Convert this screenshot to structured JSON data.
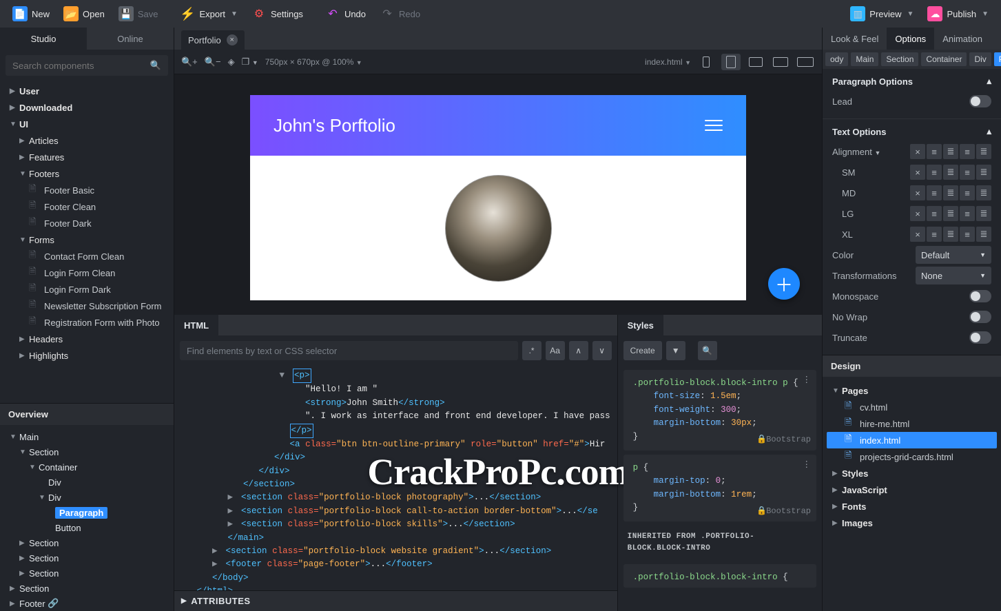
{
  "top": {
    "new": "New",
    "open": "Open",
    "save": "Save",
    "export": "Export",
    "settings": "Settings",
    "undo": "Undo",
    "redo": "Redo",
    "preview": "Preview",
    "publish": "Publish"
  },
  "leftTabs": {
    "studio": "Studio",
    "online": "Online"
  },
  "search": {
    "placeholder": "Search components"
  },
  "componentTree": {
    "user": "User",
    "downloaded": "Downloaded",
    "ui": "UI",
    "articles": "Articles",
    "features": "Features",
    "footers": "Footers",
    "footerBasic": "Footer Basic",
    "footerClean": "Footer Clean",
    "footerDark": "Footer Dark",
    "forms": "Forms",
    "contactFormClean": "Contact Form Clean",
    "loginFormClean": "Login Form Clean",
    "loginFormDark": "Login Form Dark",
    "newsletter": "Newsletter Subscription Form",
    "registration": "Registration Form with Photo",
    "headers": "Headers",
    "highlights": "Highlights"
  },
  "overview": {
    "title": "Overview",
    "main": "Main",
    "section": "Section",
    "container": "Container",
    "div": "Div",
    "paragraph": "Paragraph",
    "button": "Button",
    "footer": "Footer"
  },
  "docTab": "Portfolio",
  "dims": "750px × 670px @ 100%",
  "currentFile": "index.html",
  "pageTitle": "John's Porftolio",
  "htmlPanel": {
    "tab": "HTML",
    "findPlaceholder": "Find elements by text or CSS selector",
    "attributes": "ATTRIBUTES",
    "hello": "\"Hello! I am \"",
    "john": "John Smith",
    "workLine": "\". I work as interface and front end developer. I have pass",
    "hireText": "Hir",
    "cls1": "btn btn-outline-primary",
    "role1": "button",
    "href1": "#",
    "sec1": "portfolio-block photography",
    "sec2": "portfolio-block call-to-action border-bottom",
    "sec3": "portfolio-block skills",
    "sec4": "portfolio-block website gradient",
    "footerCls": "page-footer"
  },
  "stylesPanel": {
    "tab": "Styles",
    "create": "Create",
    "block1": {
      "selector": ".portfolio-block.block-intro p",
      "p1n": "font-size",
      "p1v": "1.5em",
      "p2n": "font-weight",
      "p2v": "300",
      "p3n": "margin-bottom",
      "p3v": "30px",
      "origin": "Bootstrap"
    },
    "block2": {
      "selector": "p",
      "p1n": "margin-top",
      "p1v": "0",
      "p2n": "margin-bottom",
      "p2v": "1rem",
      "origin": "Bootstrap"
    },
    "inherited": "INHERITED FROM .PORTFOLIO-BLOCK.BLOCK-INTRO",
    "block3sel": ".portfolio-block.block-intro"
  },
  "rightTabs": {
    "look": "Look & Feel",
    "options": "Options",
    "animation": "Animation"
  },
  "crumbs": {
    "body": "ody",
    "main": "Main",
    "section": "Section",
    "container": "Container",
    "div": "Div",
    "paragraph": "Paragraph"
  },
  "opts": {
    "paraTitle": "Paragraph Options",
    "lead": "Lead",
    "textTitle": "Text Options",
    "alignment": "Alignment",
    "sm": "SM",
    "md": "MD",
    "lg": "LG",
    "xl": "XL",
    "color": "Color",
    "colorVal": "Default",
    "trans": "Transformations",
    "transVal": "None",
    "mono": "Monospace",
    "nowrap": "No Wrap",
    "trunc": "Truncate"
  },
  "design": {
    "tab": "Design",
    "pages": "Pages",
    "cv": "cv.html",
    "hire": "hire-me.html",
    "index": "index.html",
    "projects": "projects-grid-cards.html",
    "styles": "Styles",
    "js": "JavaScript",
    "fonts": "Fonts",
    "images": "Images"
  },
  "watermark": "CrackProPc.com"
}
